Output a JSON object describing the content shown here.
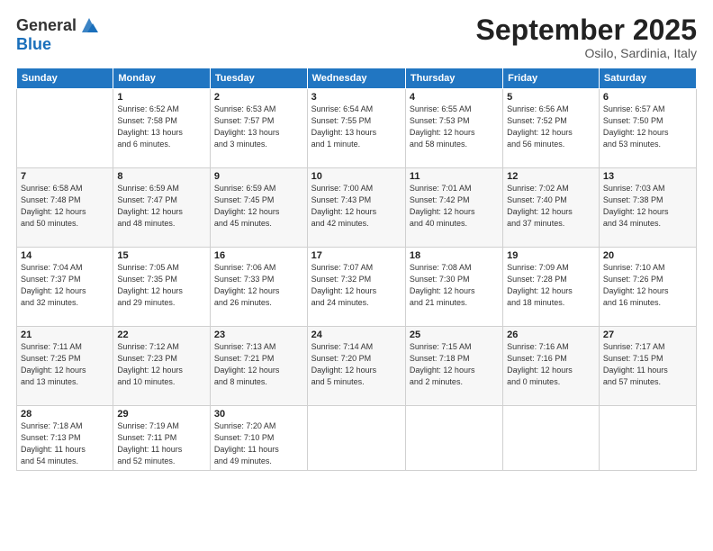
{
  "header": {
    "logo_general": "General",
    "logo_blue": "Blue",
    "title": "September 2025",
    "location": "Osilo, Sardinia, Italy"
  },
  "days_of_week": [
    "Sunday",
    "Monday",
    "Tuesday",
    "Wednesday",
    "Thursday",
    "Friday",
    "Saturday"
  ],
  "weeks": [
    [
      {
        "num": "",
        "detail": ""
      },
      {
        "num": "1",
        "detail": "Sunrise: 6:52 AM\nSunset: 7:58 PM\nDaylight: 13 hours\nand 6 minutes."
      },
      {
        "num": "2",
        "detail": "Sunrise: 6:53 AM\nSunset: 7:57 PM\nDaylight: 13 hours\nand 3 minutes."
      },
      {
        "num": "3",
        "detail": "Sunrise: 6:54 AM\nSunset: 7:55 PM\nDaylight: 13 hours\nand 1 minute."
      },
      {
        "num": "4",
        "detail": "Sunrise: 6:55 AM\nSunset: 7:53 PM\nDaylight: 12 hours\nand 58 minutes."
      },
      {
        "num": "5",
        "detail": "Sunrise: 6:56 AM\nSunset: 7:52 PM\nDaylight: 12 hours\nand 56 minutes."
      },
      {
        "num": "6",
        "detail": "Sunrise: 6:57 AM\nSunset: 7:50 PM\nDaylight: 12 hours\nand 53 minutes."
      }
    ],
    [
      {
        "num": "7",
        "detail": "Sunrise: 6:58 AM\nSunset: 7:48 PM\nDaylight: 12 hours\nand 50 minutes."
      },
      {
        "num": "8",
        "detail": "Sunrise: 6:59 AM\nSunset: 7:47 PM\nDaylight: 12 hours\nand 48 minutes."
      },
      {
        "num": "9",
        "detail": "Sunrise: 6:59 AM\nSunset: 7:45 PM\nDaylight: 12 hours\nand 45 minutes."
      },
      {
        "num": "10",
        "detail": "Sunrise: 7:00 AM\nSunset: 7:43 PM\nDaylight: 12 hours\nand 42 minutes."
      },
      {
        "num": "11",
        "detail": "Sunrise: 7:01 AM\nSunset: 7:42 PM\nDaylight: 12 hours\nand 40 minutes."
      },
      {
        "num": "12",
        "detail": "Sunrise: 7:02 AM\nSunset: 7:40 PM\nDaylight: 12 hours\nand 37 minutes."
      },
      {
        "num": "13",
        "detail": "Sunrise: 7:03 AM\nSunset: 7:38 PM\nDaylight: 12 hours\nand 34 minutes."
      }
    ],
    [
      {
        "num": "14",
        "detail": "Sunrise: 7:04 AM\nSunset: 7:37 PM\nDaylight: 12 hours\nand 32 minutes."
      },
      {
        "num": "15",
        "detail": "Sunrise: 7:05 AM\nSunset: 7:35 PM\nDaylight: 12 hours\nand 29 minutes."
      },
      {
        "num": "16",
        "detail": "Sunrise: 7:06 AM\nSunset: 7:33 PM\nDaylight: 12 hours\nand 26 minutes."
      },
      {
        "num": "17",
        "detail": "Sunrise: 7:07 AM\nSunset: 7:32 PM\nDaylight: 12 hours\nand 24 minutes."
      },
      {
        "num": "18",
        "detail": "Sunrise: 7:08 AM\nSunset: 7:30 PM\nDaylight: 12 hours\nand 21 minutes."
      },
      {
        "num": "19",
        "detail": "Sunrise: 7:09 AM\nSunset: 7:28 PM\nDaylight: 12 hours\nand 18 minutes."
      },
      {
        "num": "20",
        "detail": "Sunrise: 7:10 AM\nSunset: 7:26 PM\nDaylight: 12 hours\nand 16 minutes."
      }
    ],
    [
      {
        "num": "21",
        "detail": "Sunrise: 7:11 AM\nSunset: 7:25 PM\nDaylight: 12 hours\nand 13 minutes."
      },
      {
        "num": "22",
        "detail": "Sunrise: 7:12 AM\nSunset: 7:23 PM\nDaylight: 12 hours\nand 10 minutes."
      },
      {
        "num": "23",
        "detail": "Sunrise: 7:13 AM\nSunset: 7:21 PM\nDaylight: 12 hours\nand 8 minutes."
      },
      {
        "num": "24",
        "detail": "Sunrise: 7:14 AM\nSunset: 7:20 PM\nDaylight: 12 hours\nand 5 minutes."
      },
      {
        "num": "25",
        "detail": "Sunrise: 7:15 AM\nSunset: 7:18 PM\nDaylight: 12 hours\nand 2 minutes."
      },
      {
        "num": "26",
        "detail": "Sunrise: 7:16 AM\nSunset: 7:16 PM\nDaylight: 12 hours\nand 0 minutes."
      },
      {
        "num": "27",
        "detail": "Sunrise: 7:17 AM\nSunset: 7:15 PM\nDaylight: 11 hours\nand 57 minutes."
      }
    ],
    [
      {
        "num": "28",
        "detail": "Sunrise: 7:18 AM\nSunset: 7:13 PM\nDaylight: 11 hours\nand 54 minutes."
      },
      {
        "num": "29",
        "detail": "Sunrise: 7:19 AM\nSunset: 7:11 PM\nDaylight: 11 hours\nand 52 minutes."
      },
      {
        "num": "30",
        "detail": "Sunrise: 7:20 AM\nSunset: 7:10 PM\nDaylight: 11 hours\nand 49 minutes."
      },
      {
        "num": "",
        "detail": ""
      },
      {
        "num": "",
        "detail": ""
      },
      {
        "num": "",
        "detail": ""
      },
      {
        "num": "",
        "detail": ""
      }
    ]
  ]
}
